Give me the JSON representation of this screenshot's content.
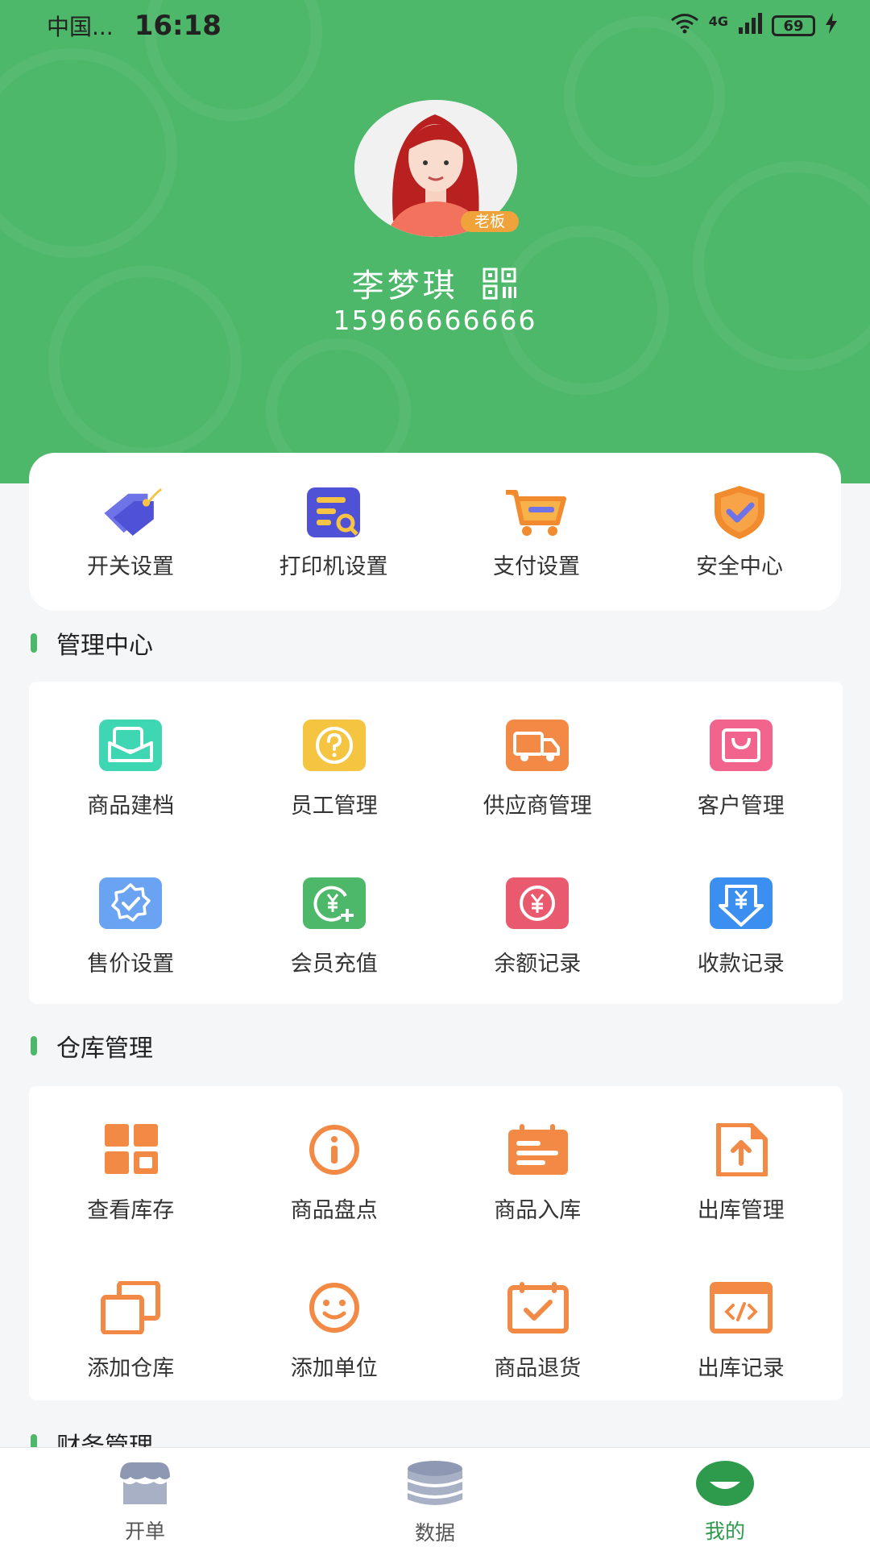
{
  "status_bar": {
    "carrier": "中国...",
    "time": "16:18",
    "network": "4G",
    "battery": "69"
  },
  "profile": {
    "role_badge": "老板",
    "name": "李梦琪",
    "phone": "15966666666"
  },
  "quick_actions": [
    {
      "label": "开关设置",
      "icon": "tag-icon"
    },
    {
      "label": "打印机设置",
      "icon": "printer-icon"
    },
    {
      "label": "支付设置",
      "icon": "cart-icon"
    },
    {
      "label": "安全中心",
      "icon": "shield-icon"
    }
  ],
  "management": {
    "title": "管理中心",
    "items": [
      {
        "label": "商品建档",
        "icon": "mail-icon",
        "color": "#3fd6b4"
      },
      {
        "label": "员工管理",
        "icon": "question-icon",
        "color": "#f5c542"
      },
      {
        "label": "供应商管理",
        "icon": "truck-icon",
        "color": "#f28a45"
      },
      {
        "label": "客户管理",
        "icon": "bag-icon",
        "color": "#f0648e"
      },
      {
        "label": "售价设置",
        "icon": "badge-check-icon",
        "color": "#6aa3f2"
      },
      {
        "label": "会员充值",
        "icon": "yen-plus-icon",
        "color": "#4db86a"
      },
      {
        "label": "余额记录",
        "icon": "yen-circle-icon",
        "color": "#ea5a6e"
      },
      {
        "label": "收款记录",
        "icon": "yen-download-icon",
        "color": "#3b8ff0"
      }
    ]
  },
  "warehouse": {
    "title": "仓库管理",
    "items": [
      {
        "label": "查看库存",
        "icon": "grid-icon"
      },
      {
        "label": "商品盘点",
        "icon": "info-icon"
      },
      {
        "label": "商品入库",
        "icon": "calendar-list-icon"
      },
      {
        "label": "出库管理",
        "icon": "file-upload-icon"
      },
      {
        "label": "添加仓库",
        "icon": "copy-icon"
      },
      {
        "label": "添加单位",
        "icon": "smile-icon"
      },
      {
        "label": "商品退货",
        "icon": "calendar-check-icon"
      },
      {
        "label": "出库记录",
        "icon": "code-window-icon"
      }
    ],
    "accent": "#f28a45"
  },
  "finance": {
    "title": "财务管理"
  },
  "tabbar": [
    {
      "label": "开单",
      "icon": "shop-icon"
    },
    {
      "label": "数据",
      "icon": "database-icon"
    },
    {
      "label": "我的",
      "icon": "profile-icon"
    }
  ]
}
